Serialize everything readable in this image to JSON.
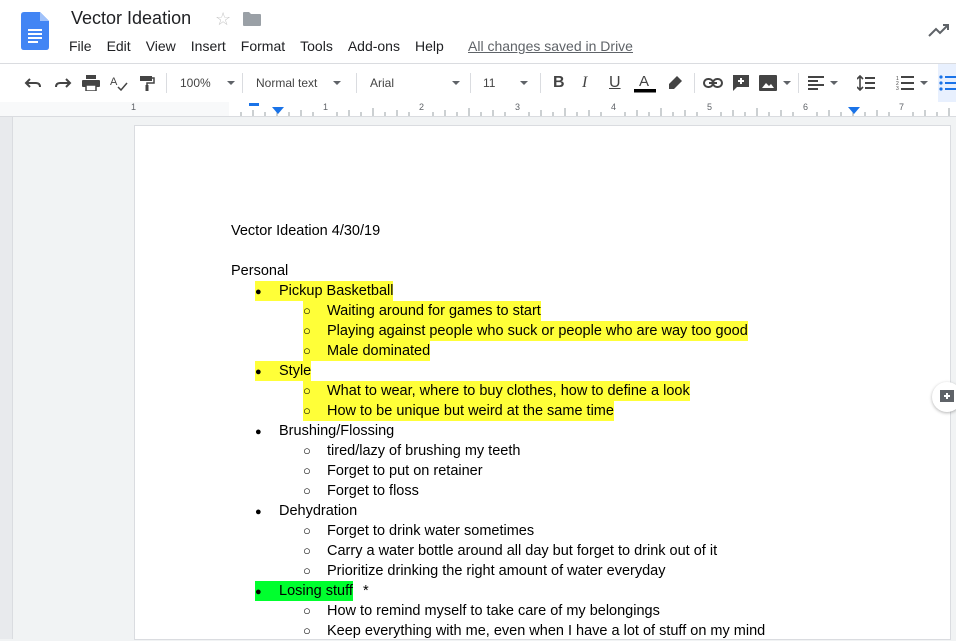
{
  "app": {
    "title": "Vector Ideation",
    "menu": [
      "File",
      "Edit",
      "View",
      "Insert",
      "Format",
      "Tools",
      "Add-ons",
      "Help"
    ],
    "saved_status": "All changes saved in Drive"
  },
  "toolbar": {
    "zoom": "100%",
    "style": "Normal text",
    "font": "Arial",
    "size": "11"
  },
  "ruler": {
    "numbers": [
      "1",
      "1",
      "2",
      "3",
      "4",
      "5",
      "6",
      "7"
    ]
  },
  "document": {
    "heading": "Vector Ideation  4/30/19",
    "section": "Personal",
    "lines": [
      {
        "level": 1,
        "text": "Pickup Basketball",
        "highlight": "yellow"
      },
      {
        "level": 2,
        "text": "Waiting around for games to start",
        "highlight": "yellow"
      },
      {
        "level": 2,
        "text": "Playing against people who suck or people who are way too good",
        "highlight": "yellow"
      },
      {
        "level": 2,
        "text": "Male dominated",
        "highlight": "yellow"
      },
      {
        "level": 1,
        "text": "Style",
        "highlight": "yellow"
      },
      {
        "level": 2,
        "text": "What to wear, where to buy clothes, how to define a look",
        "highlight": "yellow"
      },
      {
        "level": 2,
        "text": "How to be unique but weird at the same time",
        "highlight": "yellow"
      },
      {
        "level": 1,
        "text": "Brushing/Flossing",
        "highlight": "none"
      },
      {
        "level": 2,
        "text": "tired/lazy of brushing my teeth",
        "highlight": "none"
      },
      {
        "level": 2,
        "text": "Forget to put on retainer",
        "highlight": "none"
      },
      {
        "level": 2,
        "text": "Forget to floss",
        "highlight": "none"
      },
      {
        "level": 1,
        "text": "Dehydration",
        "highlight": "none"
      },
      {
        "level": 2,
        "text": "Forget to drink water sometimes",
        "highlight": "none"
      },
      {
        "level": 2,
        "text": "Carry a water bottle around all day but forget to drink out of it",
        "highlight": "none"
      },
      {
        "level": 2,
        "text": "Prioritize drinking the right amount of water everyday",
        "highlight": "none"
      },
      {
        "level": 1,
        "text": "Losing stuff ",
        "highlight": "green",
        "suffix": "*"
      },
      {
        "level": 2,
        "text": "How to remind myself to take care of my belongings",
        "highlight": "none"
      },
      {
        "level": 2,
        "text": "Keep everything with me, even when I have a lot of stuff on my mind",
        "highlight": "none"
      }
    ]
  },
  "colors": {
    "yellow_highlight": "#ffff38",
    "green_highlight": "#00ff2e",
    "docs_blue": "#4285f4"
  }
}
